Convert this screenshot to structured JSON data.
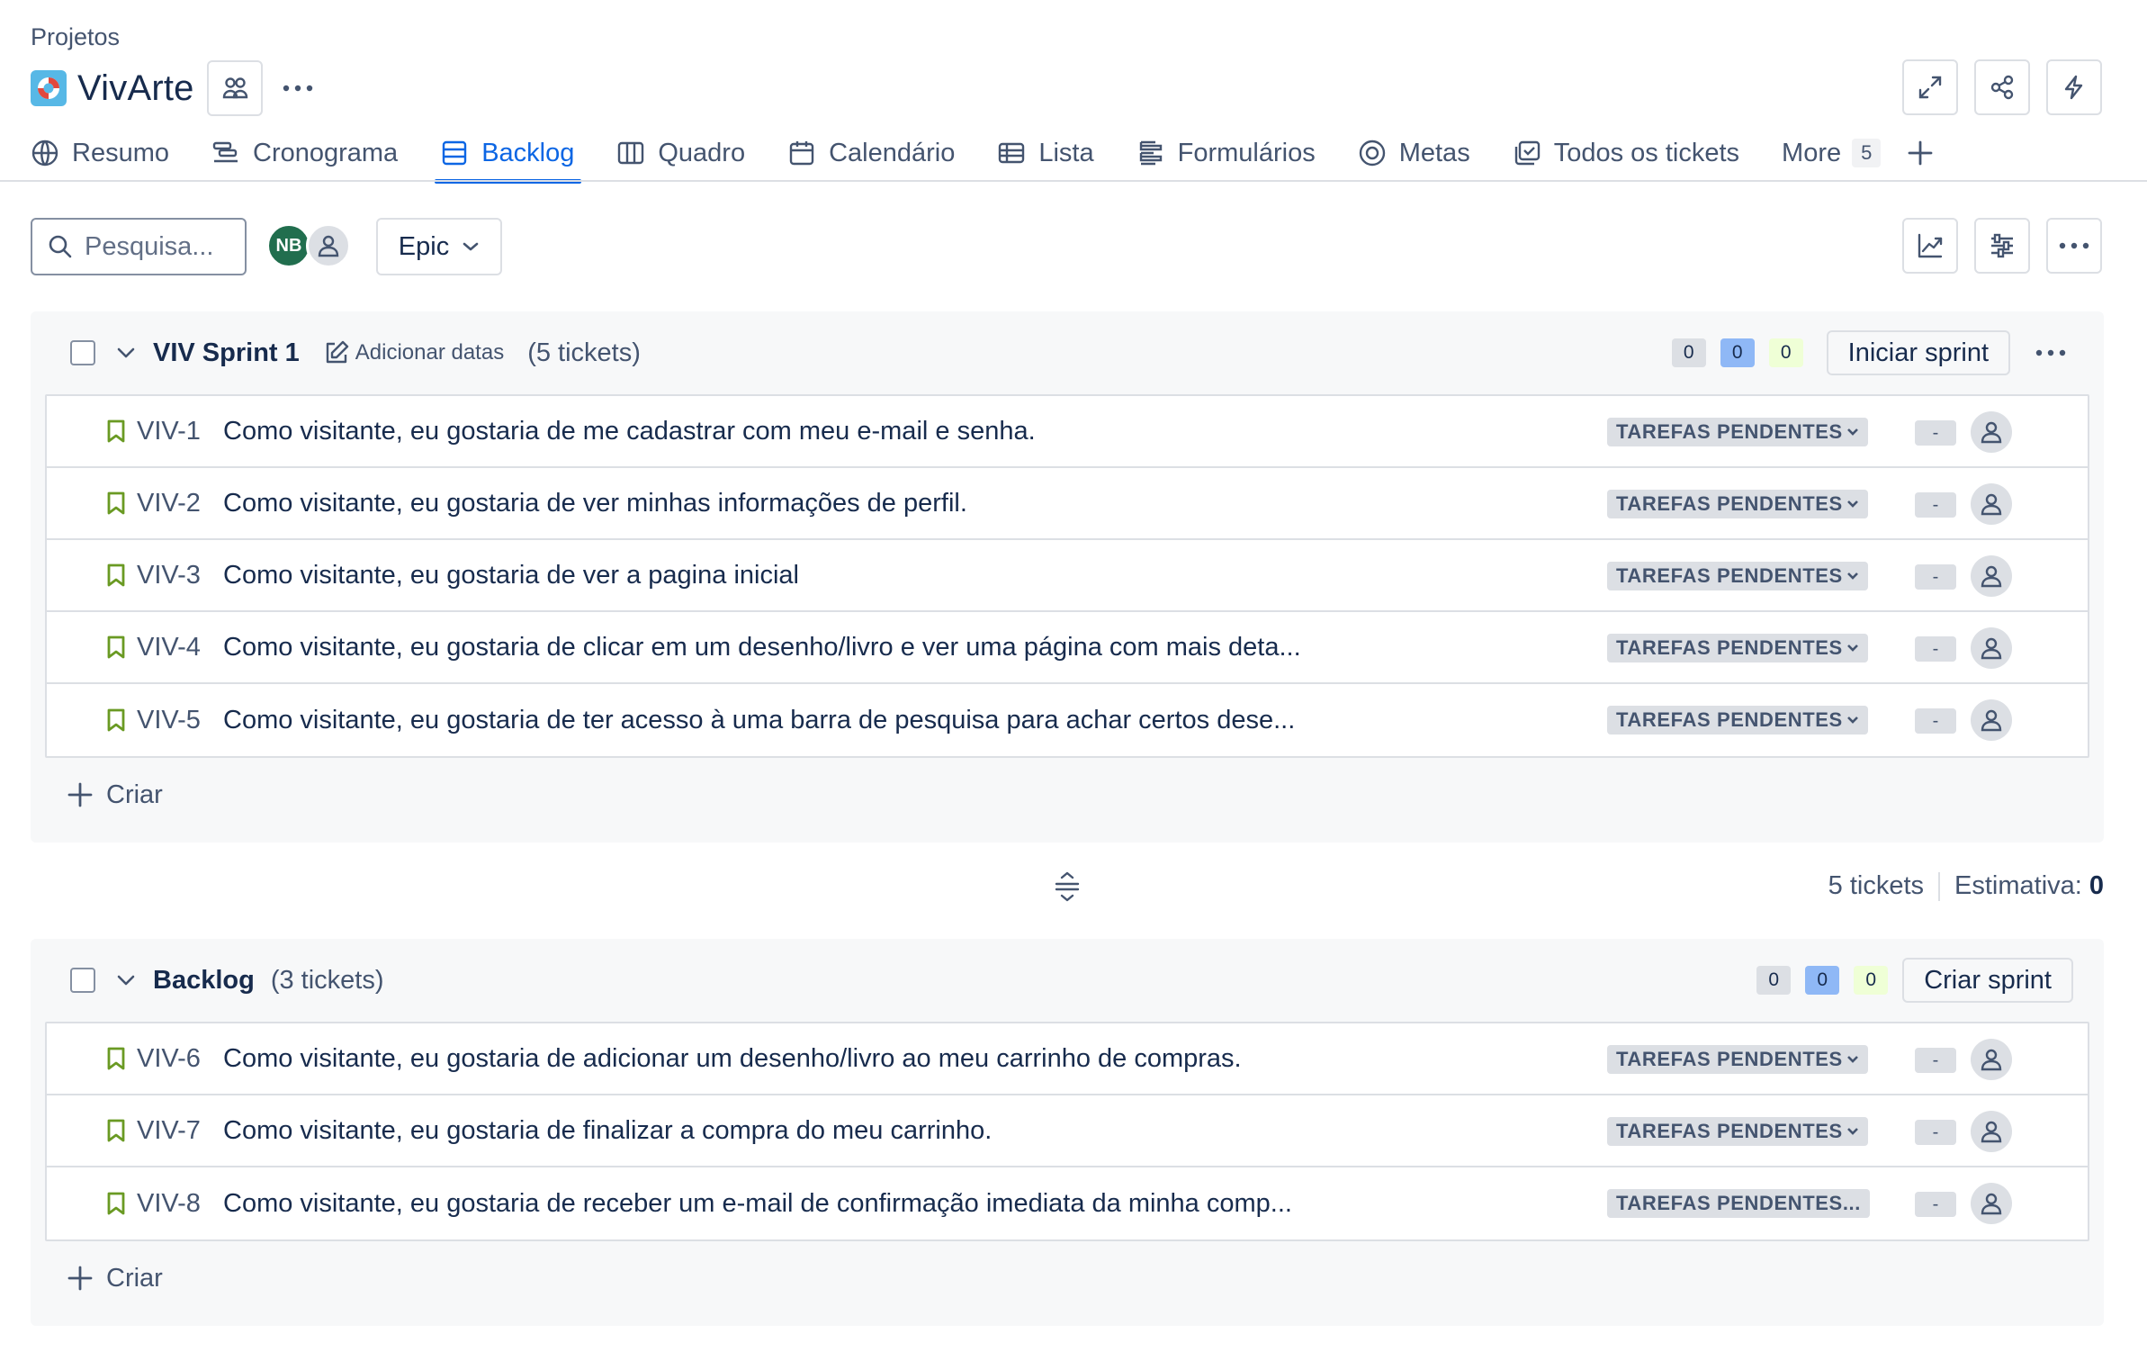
{
  "breadcrumb": "Projetos",
  "project": {
    "title": "VivArte"
  },
  "tabs": [
    {
      "label": "Resumo",
      "icon": "globe-icon"
    },
    {
      "label": "Cronograma",
      "icon": "timeline-icon"
    },
    {
      "label": "Backlog",
      "icon": "backlog-icon",
      "active": true
    },
    {
      "label": "Quadro",
      "icon": "board-icon"
    },
    {
      "label": "Calendário",
      "icon": "calendar-icon"
    },
    {
      "label": "Lista",
      "icon": "list-icon"
    },
    {
      "label": "Formulários",
      "icon": "forms-icon"
    },
    {
      "label": "Metas",
      "icon": "goal-icon"
    },
    {
      "label": "Todos os tickets",
      "icon": "tickets-icon"
    }
  ],
  "more": {
    "label": "More",
    "count": "5"
  },
  "toolbar": {
    "search_placeholder": "Pesquisa...",
    "avatar_initials": "NB",
    "epic_label": "Epic"
  },
  "sprint": {
    "name": "VIV Sprint 1",
    "add_dates": "Adicionar datas",
    "count": "(5 tickets)",
    "pills": [
      "0",
      "0",
      "0"
    ],
    "button": "Iniciar sprint",
    "create": "Criar",
    "rows": [
      {
        "key": "VIV-1",
        "summary": "Como visitante, eu gostaria de me cadastrar com meu e-mail e senha.",
        "status": "TAREFAS PENDENTES",
        "estimate": "-"
      },
      {
        "key": "VIV-2",
        "summary": "Como visitante, eu gostaria de ver minhas informações de perfil.",
        "status": "TAREFAS PENDENTES",
        "estimate": "-"
      },
      {
        "key": "VIV-3",
        "summary": "Como visitante, eu gostaria de ver a pagina inicial",
        "status": "TAREFAS PENDENTES",
        "estimate": "-"
      },
      {
        "key": "VIV-4",
        "summary": "Como visitante, eu gostaria de clicar em um desenho/livro e ver uma página com mais deta...",
        "status": "TAREFAS PENDENTES",
        "estimate": "-"
      },
      {
        "key": "VIV-5",
        "summary": "Como visitante, eu gostaria de ter acesso à uma barra de pesquisa para achar certos dese...",
        "status": "TAREFAS PENDENTES",
        "estimate": "-"
      }
    ]
  },
  "sprint_summary": {
    "tickets": "5 tickets",
    "estimate_label": "Estimativa:",
    "estimate_value": "0"
  },
  "backlog": {
    "name": "Backlog",
    "count": "(3 tickets)",
    "pills": [
      "0",
      "0",
      "0"
    ],
    "button": "Criar sprint",
    "create": "Criar",
    "rows": [
      {
        "key": "VIV-6",
        "summary": "Como visitante, eu gostaria de adicionar um desenho/livro ao meu carrinho de compras.",
        "status": "TAREFAS PENDENTES",
        "estimate": "-"
      },
      {
        "key": "VIV-7",
        "summary": "Como visitante, eu gostaria de finalizar a compra do meu carrinho.",
        "status": "TAREFAS PENDENTES",
        "estimate": "-"
      },
      {
        "key": "VIV-8",
        "summary": "Como visitante, eu gostaria de receber um e-mail de confirmação imediata da minha comp...",
        "status": "TAREFAS PENDENTES...",
        "estimate": "-"
      }
    ]
  },
  "colors": {
    "accent": "#0c66e4",
    "story": "#6a9a23",
    "avatar": "#216e4e"
  }
}
